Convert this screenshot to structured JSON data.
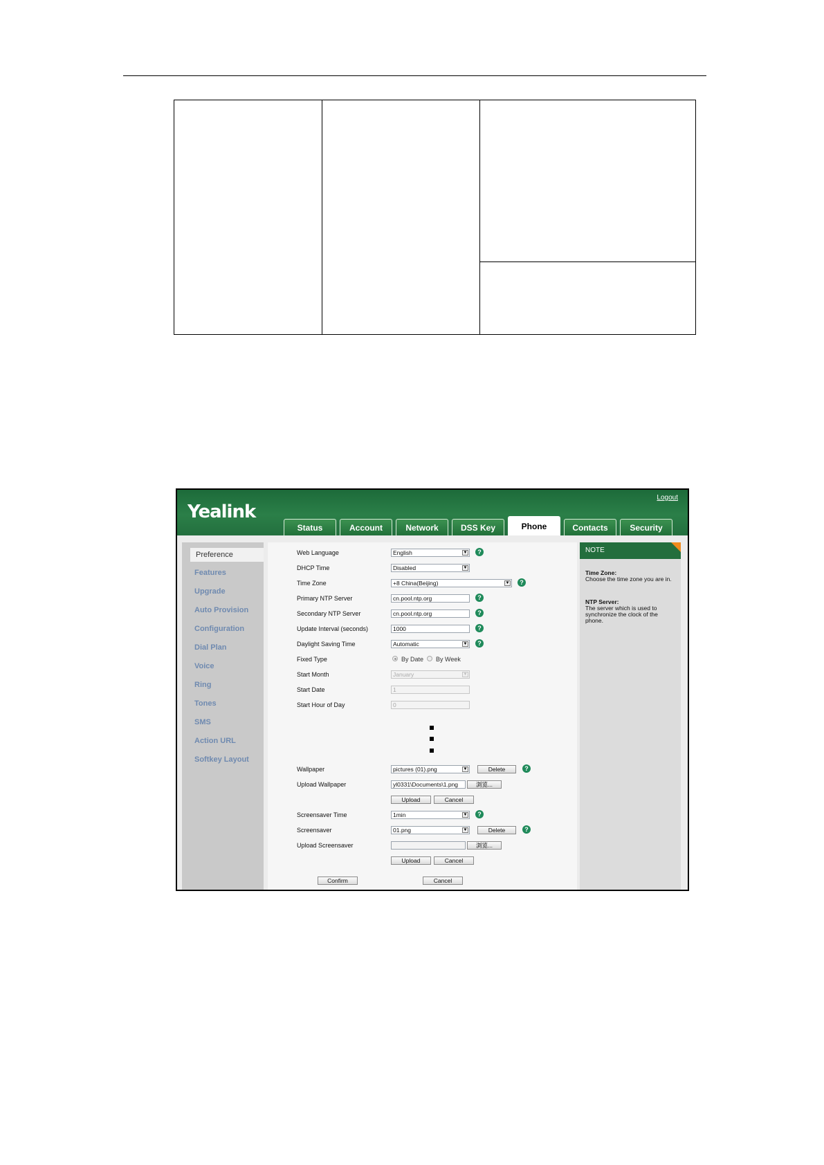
{
  "app": {
    "logo": "Yealink",
    "logout": "Logout"
  },
  "tabs": [
    "Status",
    "Account",
    "Network",
    "DSS Key",
    "Phone",
    "Contacts",
    "Security"
  ],
  "active_tab": "Phone",
  "sidebar": {
    "active": "Preference",
    "items": [
      "Features",
      "Upgrade",
      "Auto Provision",
      "Configuration",
      "Dial Plan",
      "Voice",
      "Ring",
      "Tones",
      "SMS",
      "Action URL",
      "Softkey Layout"
    ]
  },
  "form": {
    "web_language": {
      "label": "Web Language",
      "value": "English"
    },
    "dhcp_time": {
      "label": "DHCP Time",
      "value": "Disabled"
    },
    "time_zone": {
      "label": "Time Zone",
      "value": "+8 China(Beijing)"
    },
    "primary_ntp": {
      "label": "Primary NTP Server",
      "value": "cn.pool.ntp.org"
    },
    "secondary_ntp": {
      "label": "Secondary NTP Server",
      "value": "cn.pool.ntp.org"
    },
    "update_interval": {
      "label": "Update Interval (seconds)",
      "value": "1000"
    },
    "daylight_saving": {
      "label": "Daylight Saving Time",
      "value": "Automatic"
    },
    "fixed_type": {
      "label": "Fixed Type",
      "option1": "By Date",
      "option2": "By Week"
    },
    "start_month": {
      "label": "Start Month",
      "value": "January"
    },
    "start_date": {
      "label": "Start Date",
      "value": "1"
    },
    "start_hour": {
      "label": "Start Hour of Day",
      "value": "0"
    },
    "wallpaper": {
      "label": "Wallpaper",
      "value": "pictures (01).png",
      "delete": "Delete"
    },
    "upload_wallpaper": {
      "label": "Upload Wallpaper",
      "value": "yl0331\\Documents\\1.png",
      "browse": "浏览...",
      "upload": "Upload",
      "cancel": "Cancel"
    },
    "screensaver_time": {
      "label": "Screensaver Time",
      "value": "1min"
    },
    "screensaver": {
      "label": "Screensaver",
      "value": "01.png",
      "delete": "Delete"
    },
    "upload_screensaver": {
      "label": "Upload Screensaver",
      "value": "",
      "browse": "浏览...",
      "upload": "Upload",
      "cancel": "Cancel"
    },
    "confirm": "Confirm",
    "cancel": "Cancel"
  },
  "note": {
    "header": "NOTE",
    "time_zone_title": "Time Zone:",
    "time_zone_text": "Choose the time zone you are in.",
    "ntp_title": "NTP Server:",
    "ntp_text": "The server which is used to synchronize the clock of the phone."
  },
  "colors": {
    "header_green": "#2b7f48",
    "note_header": "#236e3d",
    "note_corner": "#f08a1c",
    "help_icon": "#1f8a5a",
    "sidebar_link": "#6f8ab0"
  }
}
